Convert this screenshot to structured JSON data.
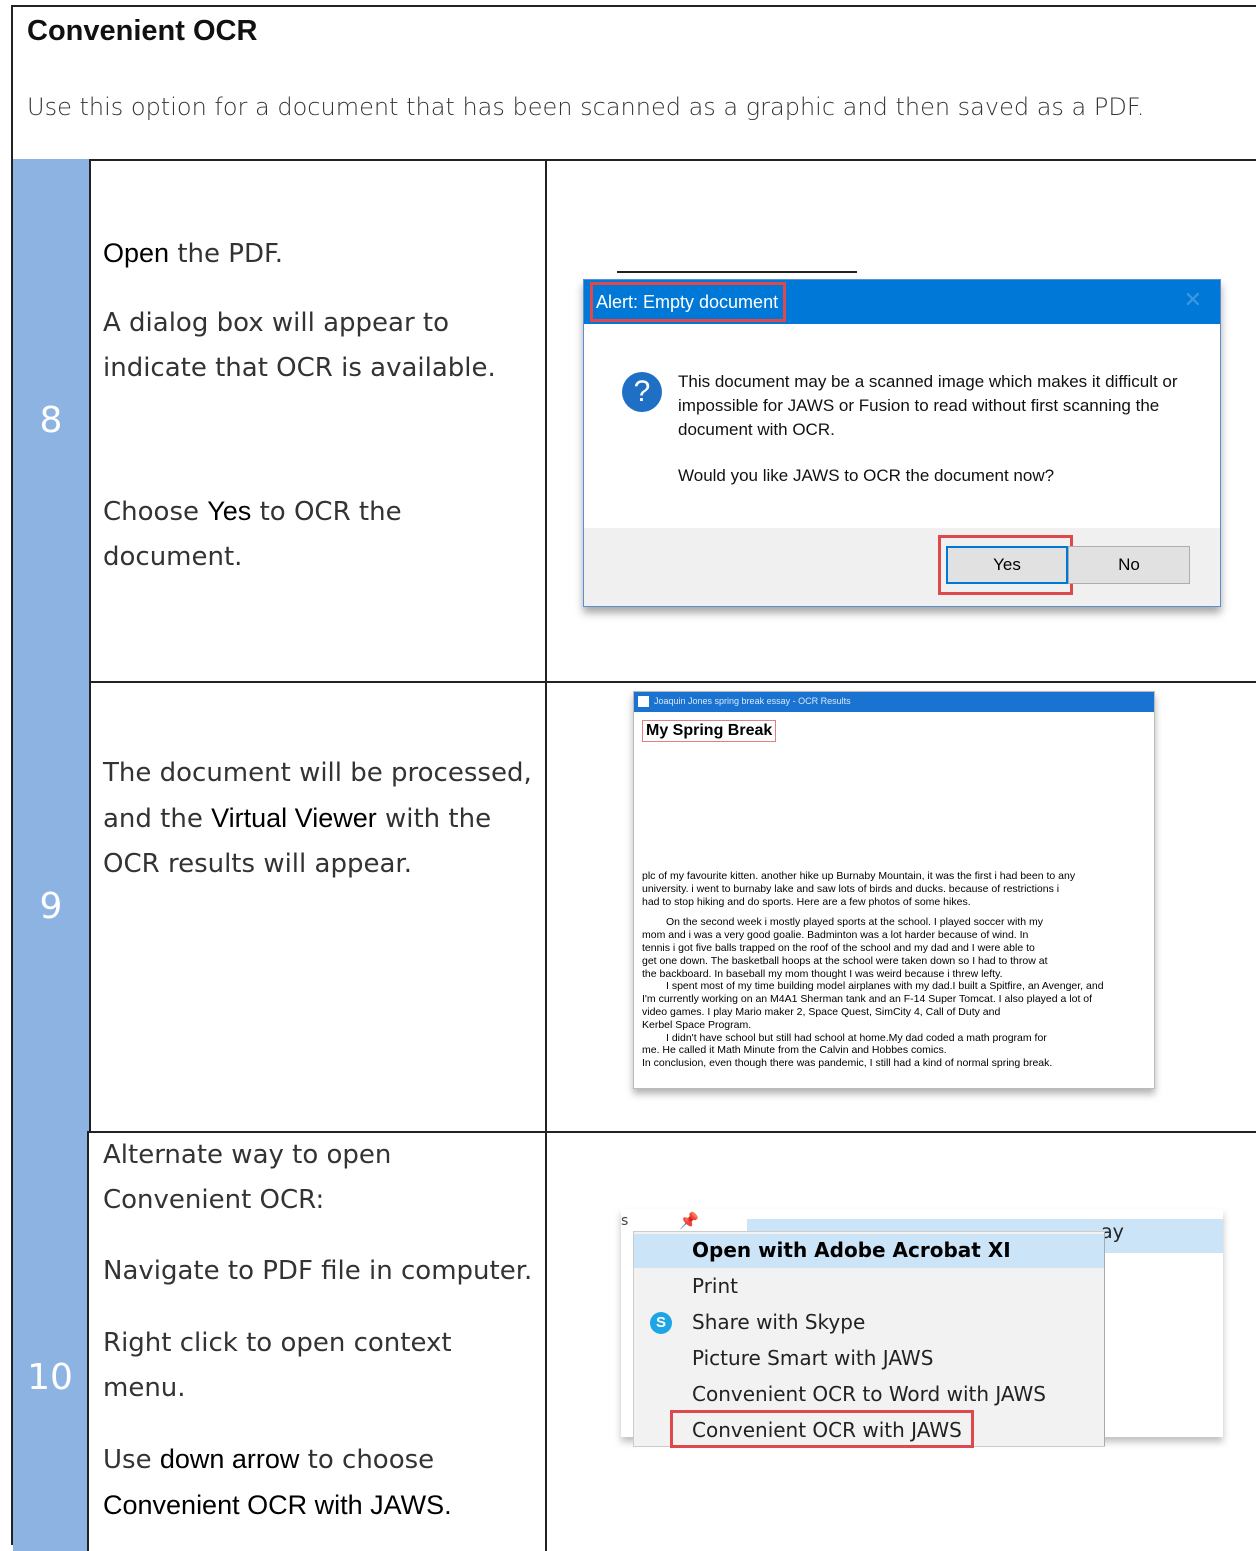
{
  "header": {
    "title": "Convenient OCR",
    "description": "Use this option for a document that has been scanned as a graphic and then saved as a PDF."
  },
  "steps": [
    {
      "number": "8",
      "lines": [
        [
          "Open",
          " the PDF."
        ],
        [
          "A dialog box will appear to",
          "indicate that OCR is available."
        ],
        [
          "Choose ",
          "Yes",
          " to OCR the",
          "document."
        ]
      ]
    },
    {
      "number": "9",
      "text_a": "The document will be processed,",
      "text_b": "and the ",
      "text_b_bold": "Virtual Viewer",
      "text_b_end": " with the",
      "text_c": "OCR results will appear."
    },
    {
      "number": "10",
      "text_a": "Alternate way to open",
      "text_b": "Convenient OCR:",
      "text_c": "Navigate to PDF file in computer.",
      "text_d": "Right click to open context",
      "text_e": "menu.",
      "text_f_pre": "Use ",
      "text_f_bold": "down arrow",
      "text_f_post": " to choose",
      "text_g_bold": "Convenient OCR with JAWS."
    }
  ],
  "dialog": {
    "title": "Alert: Empty document",
    "close": "✕",
    "icon": "?",
    "message": "This document may be a scanned image which makes it difficult or impossible for JAWS or Fusion to read without first scanning the document with OCR.",
    "question": "Would you like JAWS to OCR the document now?",
    "yes": "Yes",
    "no": "No"
  },
  "ocr_window": {
    "title": "Joaquin Jones spring break essay - OCR Results",
    "heading": "My Spring Break",
    "lines": [
      "plc of my favourite kitten. another hike up Burnaby Mountain, it was the first i had been to any",
      "university. i went to burnaby lake and saw lots of birds and ducks. because of restrictions i",
      "had to stop hiking and do sports. Here are a few photos of some hikes.",
      "On the second week i mostly played sports at the school. I played soccer with my",
      "mom and i was a very good goalie. Badminton was a lot harder because of wind. In",
      "tennis i got five balls trapped on the roof of the school and my dad and I were able to",
      "get one down. The basketball hoops at the school were taken down so I had to throw at",
      "the backboard. In baseball my mom thought I was weird because i threw lefty.",
      "I spent most of my time building model airplanes with my dad.I built a Spitfire, an Avenger, and",
      "I'm currently working on an M4A1 Sherman tank and an F-14 Super Tomcat. I also played a lot of",
      "video games. I play Mario maker 2, Space Quest, SimCity 4, Call of Duty and",
      "Kerbel Space Program.",
      "I didn't have school but still had school at home.My dad coded a math program for",
      "me. He called it Math Minute from the Calvin and Hobbes comics.",
      "In conclusion, even though there was pandemic, I still had a kind of normal spring break."
    ]
  },
  "context_menu": {
    "bg_text": "ay",
    "bg_s": "s",
    "items": [
      "Open with Adobe Acrobat XI",
      "Print",
      "Share with Skype",
      "Picture Smart with JAWS",
      "Convenient OCR to Word with JAWS",
      "Convenient OCR with JAWS"
    ],
    "skype_icon": "S"
  },
  "colors": {
    "step_number_bg": "#8db3e2",
    "dialog_bar": "#0078d7",
    "highlight_box": "#e0494b"
  }
}
